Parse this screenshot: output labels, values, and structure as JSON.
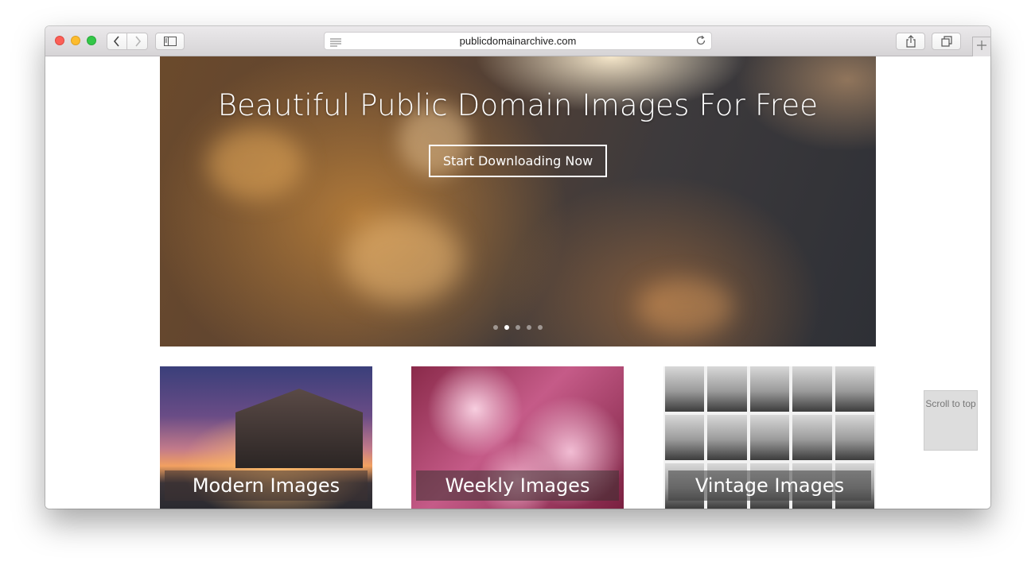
{
  "browser": {
    "url": "publicdomainarchive.com",
    "icons": {
      "back": "chevron-left-icon",
      "forward": "chevron-right-icon",
      "sidebar": "sidebar-icon",
      "reader": "reader-list-icon",
      "reload": "reload-icon",
      "share": "share-icon",
      "tabs": "tabs-overview-icon",
      "new_tab": "plus-icon"
    },
    "traffic_lights": {
      "close": "#fc5f57",
      "minimize": "#fdbc2e",
      "zoom": "#33c748"
    }
  },
  "hero": {
    "title": "Beautiful Public Domain Images For Free",
    "button_label": "Start Downloading Now",
    "slide_count": 5,
    "active_slide": 2
  },
  "cards": [
    {
      "label": "Modern Images"
    },
    {
      "label": "Weekly Images"
    },
    {
      "label": "Vintage Images"
    }
  ],
  "scroll_to_top": {
    "label": "Scroll to top"
  }
}
